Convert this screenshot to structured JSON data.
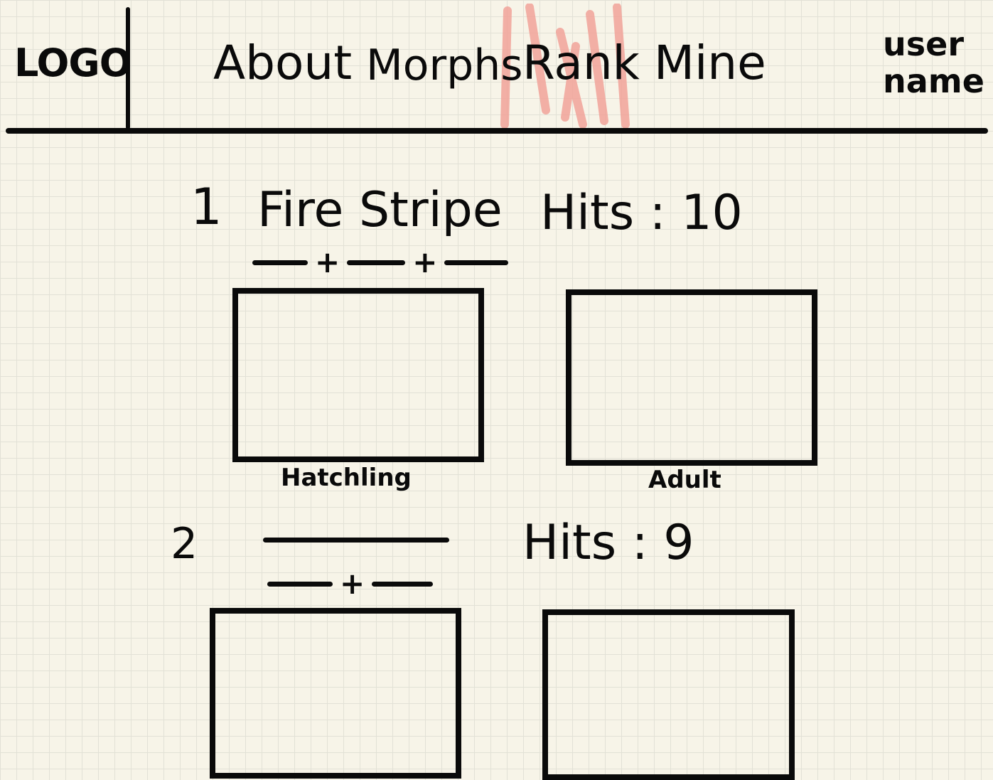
{
  "header": {
    "logo": "LOGO",
    "nav": [
      "About",
      "Morphs",
      "Rank",
      "Mine"
    ],
    "active_tab": "Rank",
    "active_highlight_color": "#f2a39a",
    "user_name_line1": "user",
    "user_name_line2": "name"
  },
  "entries": [
    {
      "rank": "1",
      "name": "Fire Stripe",
      "hits_label": "Hits : 10",
      "hatchling_label": "Hatchling",
      "adult_label": "Adult"
    },
    {
      "rank": "2",
      "name": "",
      "hits_label": "Hits : 9"
    }
  ]
}
